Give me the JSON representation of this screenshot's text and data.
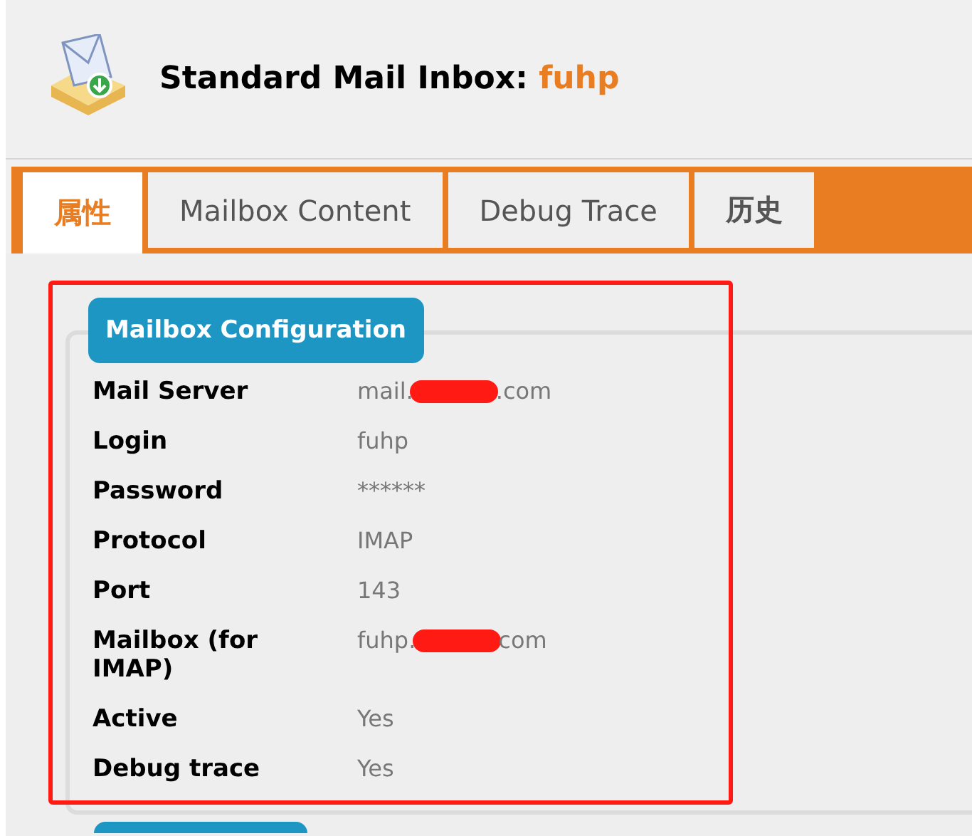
{
  "header": {
    "title": "Standard Mail Inbox:",
    "name": "fuhp"
  },
  "tabs": [
    {
      "label": "属性",
      "selected": true
    },
    {
      "label": "Mailbox Content",
      "selected": false
    },
    {
      "label": "Debug Trace",
      "selected": false
    },
    {
      "label": "历史",
      "selected": false
    }
  ],
  "section": {
    "title": "Mailbox Configuration",
    "rows": [
      {
        "label": "Mail Server",
        "value_start": "mail.",
        "value_end": ".com",
        "redacted": true
      },
      {
        "label": "Login",
        "value_start": "fuhp",
        "redacted": false
      },
      {
        "label": "Password",
        "value_start": "******",
        "redacted": false
      },
      {
        "label": "Protocol",
        "value_start": "IMAP",
        "redacted": false
      },
      {
        "label": "Port",
        "value_start": "143",
        "redacted": false
      },
      {
        "label": "Mailbox (for IMAP)",
        "value_start": "fuhp.",
        "value_end": "com",
        "redacted": true
      },
      {
        "label": "Active",
        "value_start": "Yes",
        "redacted": false
      },
      {
        "label": "Debug trace",
        "value_start": "Yes",
        "redacted": false
      }
    ]
  }
}
